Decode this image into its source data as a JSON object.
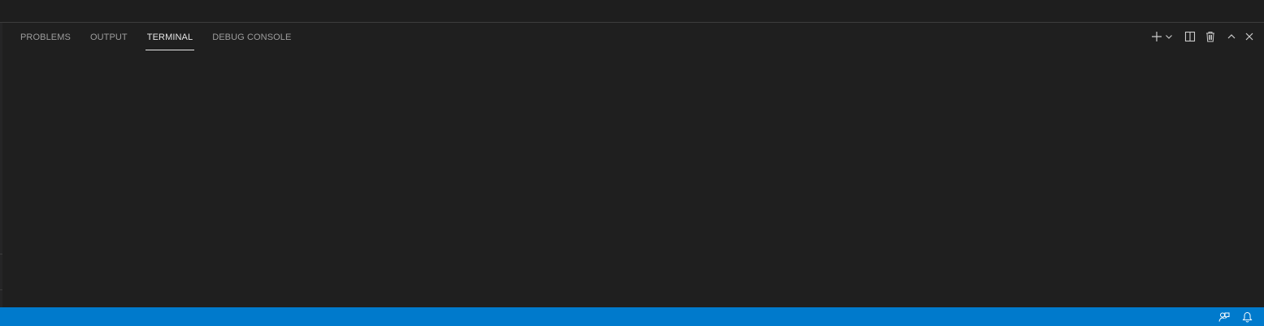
{
  "panel": {
    "tabs": [
      {
        "label": "PROBLEMS",
        "active": false
      },
      {
        "label": "OUTPUT",
        "active": false
      },
      {
        "label": "TERMINAL",
        "active": true
      },
      {
        "label": "DEBUG CONSOLE",
        "active": false
      }
    ],
    "actions": [
      {
        "icon": "plus-icon",
        "title": "New Terminal"
      },
      {
        "icon": "chevron-down-icon",
        "title": "Launch Profile"
      },
      {
        "icon": "split-icon",
        "title": "Split Terminal"
      },
      {
        "icon": "trash-icon",
        "title": "Kill Terminal"
      },
      {
        "icon": "chevron-up-icon",
        "title": "Maximize Panel Size"
      },
      {
        "icon": "close-icon",
        "title": "Close Panel"
      }
    ]
  },
  "statusbar": {
    "items": [
      {
        "icon": "feedback-icon"
      },
      {
        "icon": "bell-icon"
      }
    ]
  },
  "colors": {
    "statusbar_bg": "#007acc",
    "panel_bg": "#1f1f1f",
    "tab_active": "#e7e7e7",
    "tab_inactive": "#9d9d9d"
  }
}
